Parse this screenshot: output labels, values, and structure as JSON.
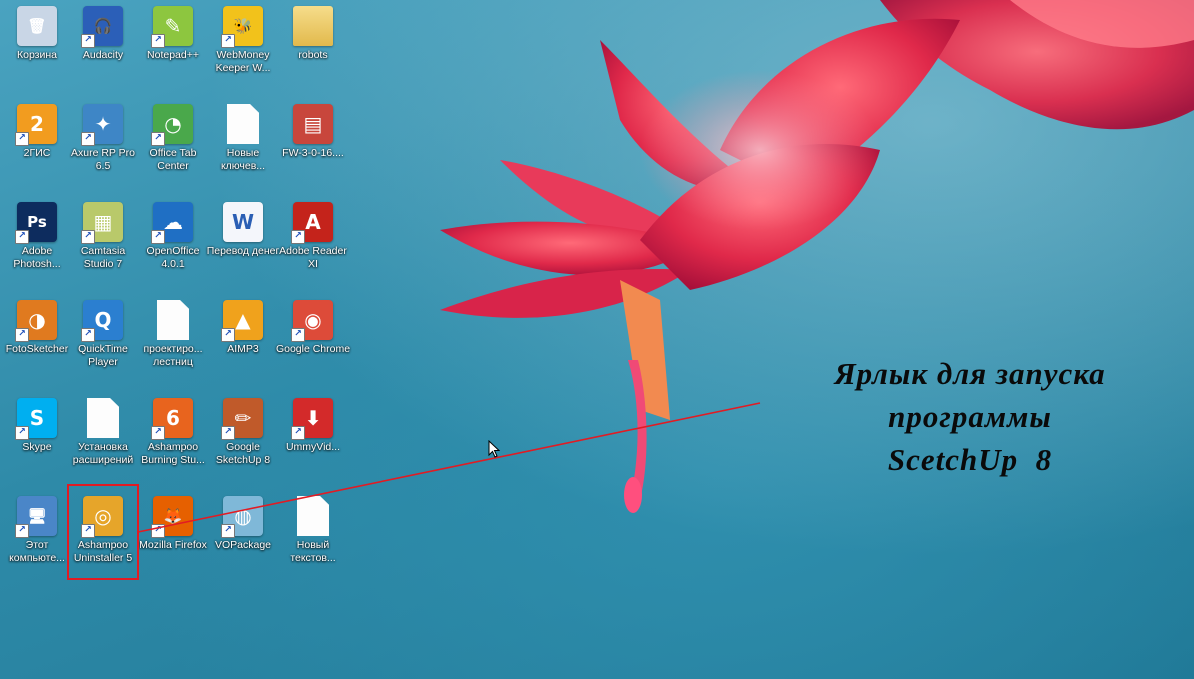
{
  "desktop": {
    "icons": [
      {
        "label": "Корзина",
        "icon": "recycle-bin-icon",
        "color": "#c9d6e6",
        "glyph": "🗑"
      },
      {
        "label": "Audacity",
        "icon": "audacity-icon",
        "color": "#2b5fb8",
        "glyph": "🎧"
      },
      {
        "label": "Notepad++",
        "icon": "notepad-plus-plus-icon",
        "color": "#8dc63f",
        "glyph": "✎"
      },
      {
        "label": "WebMoney Keeper W...",
        "icon": "webmoney-icon",
        "color": "#f2c21b",
        "glyph": "🐝"
      },
      {
        "label": "robots",
        "icon": "folder-icon",
        "color": "#e8c35a",
        "glyph": ""
      },
      {
        "label": "2ГИС",
        "icon": "2gis-icon",
        "color": "#f29c1f",
        "glyph": "2"
      },
      {
        "label": "Axure RP Pro 6.5",
        "icon": "axure-icon",
        "color": "#3e86c6",
        "glyph": "✦"
      },
      {
        "label": "Office Tab Center",
        "icon": "office-tab-icon",
        "color": "#4aa84b",
        "glyph": "◔"
      },
      {
        "label": "Новые ключев...",
        "icon": "text-document-icon",
        "color": "#ffffff",
        "glyph": ""
      },
      {
        "label": "FW-3-0-16....",
        "icon": "winrar-archive-icon",
        "color": "#c8463c",
        "glyph": "▤"
      },
      {
        "label": "Adobe Photosh...",
        "icon": "photoshop-icon",
        "color": "#0d2c5e",
        "glyph": "Ps"
      },
      {
        "label": "Camtasia Studio 7",
        "icon": "camtasia-icon",
        "color": "#b9c96a",
        "glyph": "▦"
      },
      {
        "label": "OpenOffice 4.0.1",
        "icon": "openoffice-icon",
        "color": "#1f6fc4",
        "glyph": "☁"
      },
      {
        "label": "Перевод денег",
        "icon": "word-document-icon",
        "color": "#2a5eb4",
        "glyph": "W"
      },
      {
        "label": "Adobe Reader XI",
        "icon": "adobe-reader-icon",
        "color": "#c4231b",
        "glyph": "A"
      },
      {
        "label": "FotoSketcher",
        "icon": "fotosketcher-icon",
        "color": "#e07a1f",
        "glyph": "◑"
      },
      {
        "label": "QuickTime Player",
        "icon": "quicktime-icon",
        "color": "#2b7fd0",
        "glyph": "Q"
      },
      {
        "label": "проектиро... лестниц",
        "icon": "text-document-icon",
        "color": "#ffffff",
        "glyph": ""
      },
      {
        "label": "AIMP3",
        "icon": "aimp-icon",
        "color": "#f0a21c",
        "glyph": "▲"
      },
      {
        "label": "Google Chrome",
        "icon": "chrome-icon",
        "color": "#dd4b39",
        "glyph": "◉"
      },
      {
        "label": "Skype",
        "icon": "skype-icon",
        "color": "#00aff0",
        "glyph": "S"
      },
      {
        "label": "Установка расширений",
        "icon": "text-document-icon",
        "color": "#ffffff",
        "glyph": ""
      },
      {
        "label": "Ashampoo Burning Stu...",
        "icon": "ashampoo-burning-icon",
        "color": "#e8641e",
        "glyph": "6"
      },
      {
        "label": "Google SketchUp 8",
        "icon": "sketchup-icon",
        "color": "#c05a2a",
        "glyph": "✏"
      },
      {
        "label": "UmmyVid...",
        "icon": "ummy-video-icon",
        "color": "#d32a2a",
        "glyph": "⬇"
      },
      {
        "label": "Этот компьюте...",
        "icon": "this-pc-icon",
        "color": "#4a86c8",
        "glyph": "🖥"
      },
      {
        "label": "Ashampoo Uninstaller 5",
        "icon": "ashampoo-uninstaller-icon",
        "color": "#e6a52a",
        "glyph": "◎"
      },
      {
        "label": "Mozilla Firefox",
        "icon": "firefox-icon",
        "color": "#e66000",
        "glyph": "🦊"
      },
      {
        "label": "VOPackage",
        "icon": "vopackage-icon",
        "color": "#7fb8d8",
        "glyph": "◍"
      },
      {
        "label": "Новый текстов...",
        "icon": "text-document-icon",
        "color": "#ffffff",
        "glyph": ""
      }
    ]
  },
  "annotation": {
    "line1": "Ярлык для запуска",
    "line2": "программы",
    "line3": "ScetchUp  8",
    "color": "#e21b23"
  }
}
